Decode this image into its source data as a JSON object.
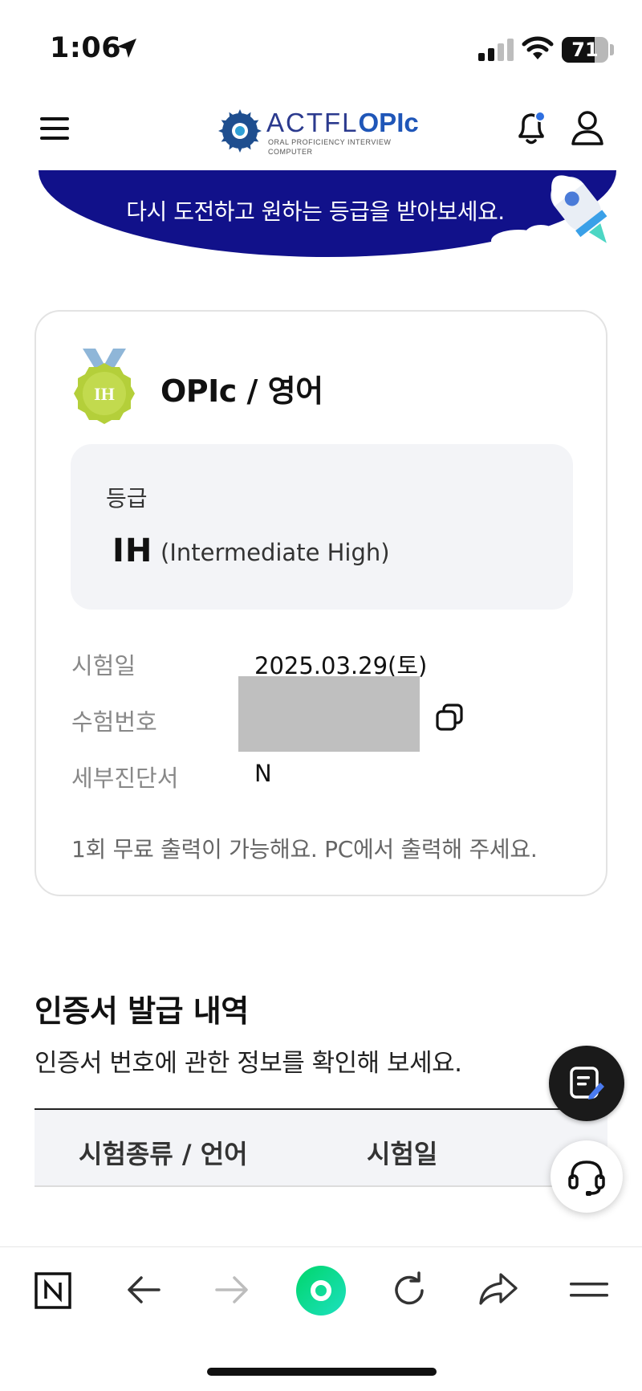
{
  "status_bar": {
    "time": "1:06",
    "battery": "71",
    "battery_level": 0.71
  },
  "header": {
    "logo": {
      "brand": "ACTFL",
      "product": "OPIc",
      "tagline": "ORAL PROFICIENCY INTERVIEW",
      "tagline2": "COMPUTER"
    },
    "icons": [
      "menu-icon",
      "bell-icon",
      "user-icon"
    ],
    "notification_dot_color": "#2f6fe0"
  },
  "banner": {
    "text": "다시 도전하고 원하는 등급을 받아보세요.",
    "bg_color": "#11118a"
  },
  "result_card": {
    "medal_label": "IH",
    "title": "OPIc / 영어",
    "grade": {
      "label": "등급",
      "code": "IH",
      "description": "(Intermediate High)"
    },
    "rows": [
      {
        "label": "시험일",
        "value": "2025.03.29(토)"
      },
      {
        "label": "수험번호",
        "value": ""
      },
      {
        "label": "세부진단서",
        "value": "N"
      }
    ],
    "note": "1회 무료 출력이 가능해요. PC에서 출력해 주세요."
  },
  "certificates": {
    "title": "인증서 발급 내역",
    "subtitle": "인증서 번호에 관한 정보를 확인해 보세요.",
    "columns": [
      "시험종류 / 언어",
      "시험일"
    ]
  },
  "floating": {
    "write_icon": "note-edit-icon",
    "support_icon": "headset-icon"
  },
  "browser_bar": {
    "buttons": [
      "naver-icon",
      "back-icon",
      "forward-icon",
      "home-icon",
      "reload-icon",
      "share-icon",
      "menu-icon"
    ],
    "home_color": "#03c75a"
  }
}
